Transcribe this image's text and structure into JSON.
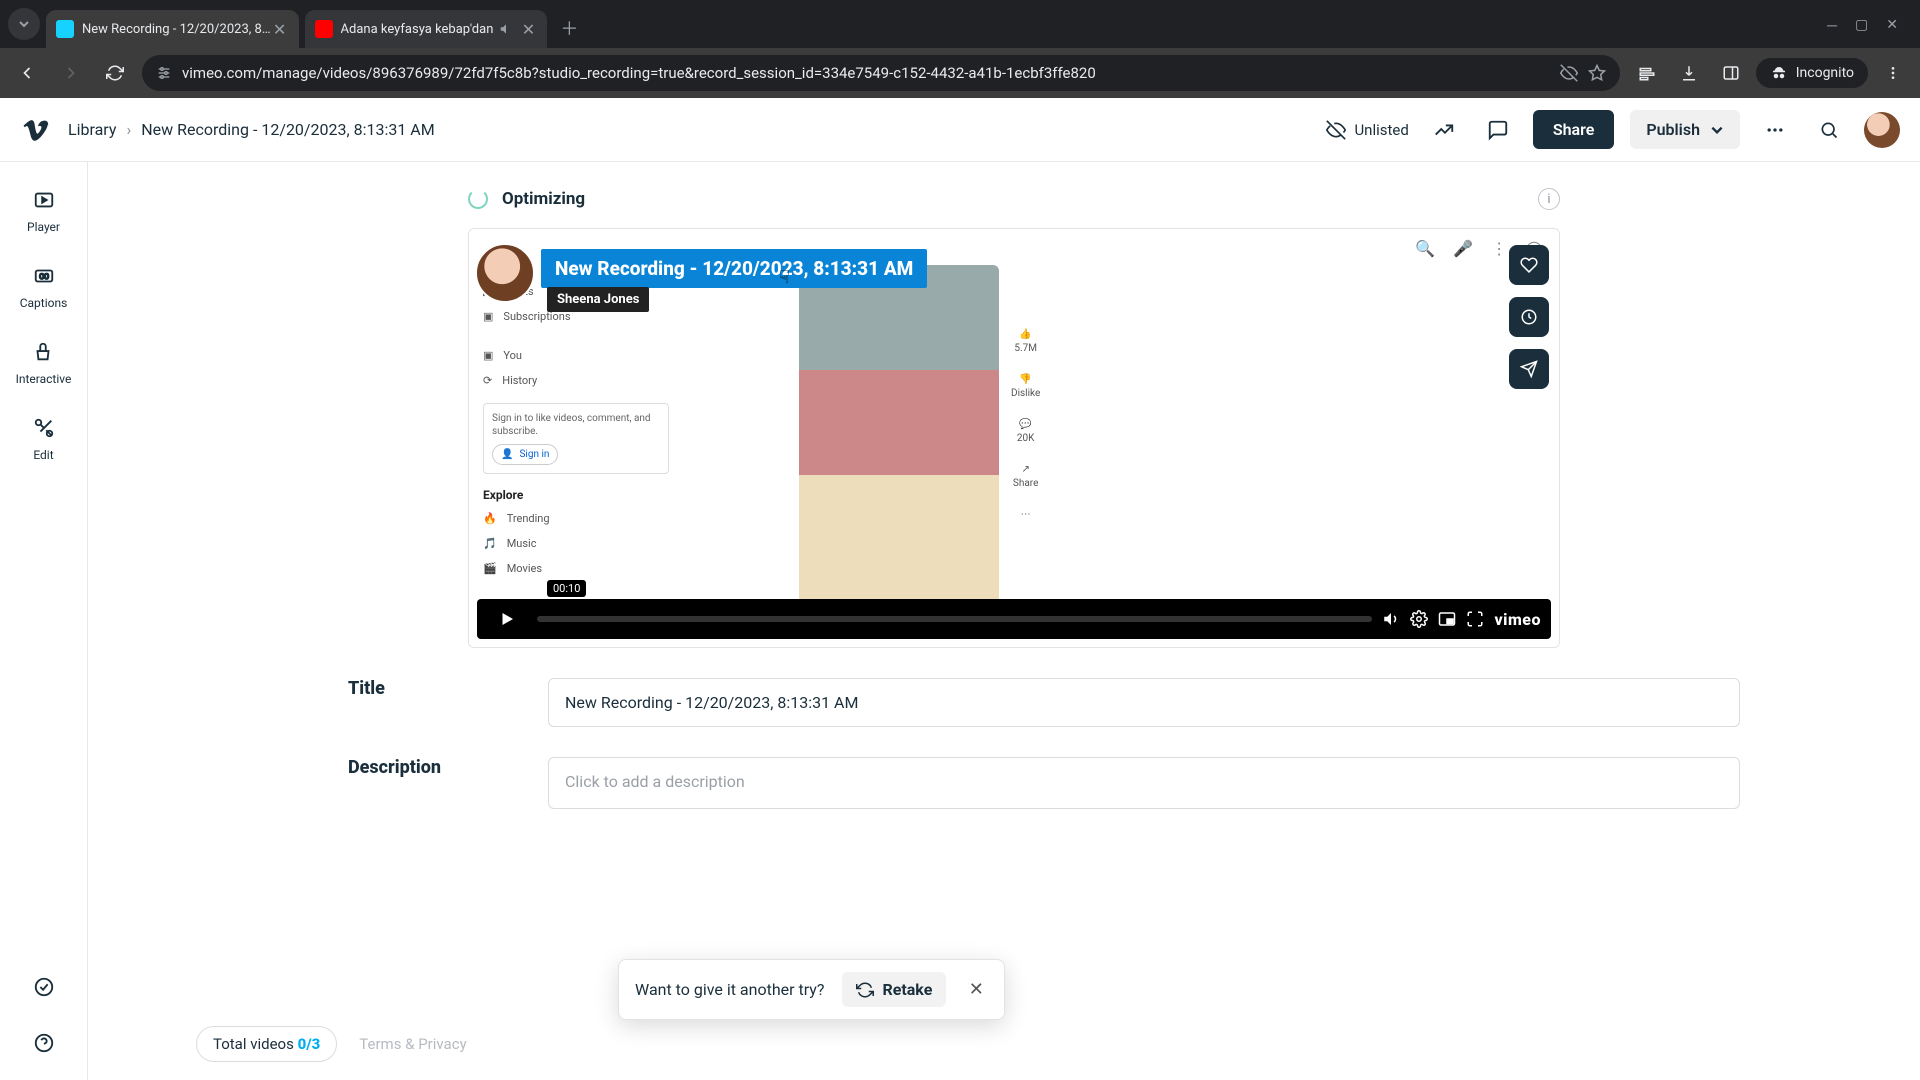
{
  "browser": {
    "tabs": [
      {
        "title": "New Recording - 12/20/2023, 8…",
        "favicon": "#17d1ff",
        "active": true
      },
      {
        "title": "Adana keyfasya kebap'dan",
        "favicon": "#ff0000",
        "active": false,
        "audio": true
      }
    ],
    "url": "vimeo.com/manage/videos/896376989/72fd7f5c8b?studio_recording=true&record_session_id=334e7549-c152-4432-a41b-1ecbf3ffe820",
    "incognito_label": "Incognito"
  },
  "header": {
    "breadcrumb_root": "Library",
    "breadcrumb_current": "New Recording - 12/20/2023, 8:13:31 AM",
    "privacy": "Unlisted",
    "share": "Share",
    "publish": "Publish"
  },
  "rail": {
    "items": [
      "Player",
      "Captions",
      "Interactive",
      "Edit"
    ]
  },
  "status": {
    "text": "Optimizing"
  },
  "video": {
    "title_overlay": "New Recording - 12/20/2023, 8:13:31 AM",
    "presenter": "Sheena Jones",
    "time_tip": "00:10",
    "brand": "vimeo",
    "yt_sidebar": {
      "shorts": "Shorts",
      "subscriptions": "Subscriptions",
      "you": "You",
      "history": "History",
      "signin_prompt": "Sign in to like videos, comment, and subscribe.",
      "signin": "Sign in",
      "explore": "Explore",
      "trending": "Trending",
      "music": "Music",
      "movies": "Movies"
    },
    "short_stats": {
      "likes": "5.7M",
      "dislike": "Dislike",
      "comments": "20K",
      "share": "Share"
    }
  },
  "form": {
    "title_label": "Title",
    "title_value": "New Recording - 12/20/2023, 8:13:31 AM",
    "description_label": "Description",
    "description_placeholder": "Click to add a description"
  },
  "toast": {
    "message": "Want to give it another try?",
    "retake": "Retake"
  },
  "footer": {
    "total_label": "Total videos ",
    "total_count": "0/3",
    "terms": "Terms & Privacy"
  }
}
